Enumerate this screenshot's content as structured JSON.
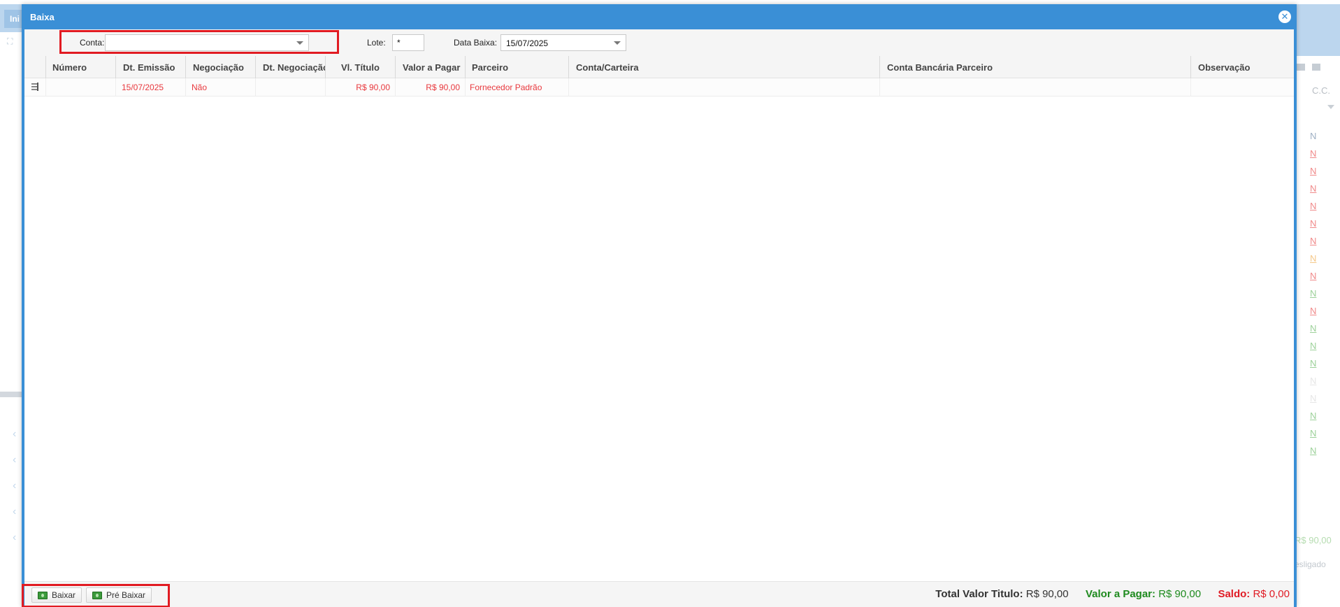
{
  "background": {
    "start_tab": "Ini",
    "cc_label": "C.C.",
    "status_letters": [
      "N",
      "N",
      "N",
      "N",
      "N",
      "N",
      "N",
      "N",
      "N",
      "N",
      "N",
      "N",
      "N",
      "N",
      "N",
      "N",
      "N",
      "N",
      "N"
    ],
    "status_colors": [
      "#9fb0c4",
      "#f08a8a",
      "#f08a8a",
      "#f08a8a",
      "#f08a8a",
      "#f08a8a",
      "#f08a8a",
      "#f5c98a",
      "#f08a8a",
      "#9dd19a",
      "#f08a8a",
      "#9dd19a",
      "#9dd19a",
      "#9dd19a",
      "#e6e6e6",
      "#e6e6e6",
      "#9dd19a",
      "#9dd19a",
      "#9dd19a"
    ],
    "partial_total": "R$ 90,00",
    "partial_status": "esligado"
  },
  "modal": {
    "title": "Baixa",
    "toolbar": {
      "conta_label": "Conta:",
      "conta_value": "",
      "lote_label": "Lote:",
      "lote_value": "*",
      "data_baixa_label": "Data Baixa:",
      "data_baixa_value": "15/07/2025"
    },
    "columns": [
      "Número",
      "Dt. Emissão",
      "Negociação",
      "Dt. Negociação",
      "Vl. Título",
      "Valor a Pagar",
      "Parceiro",
      "Conta/Carteira",
      "Conta Bancária Parceiro",
      "Observação"
    ],
    "rows": [
      {
        "numero": "",
        "dt_emissao": "15/07/2025",
        "negociacao": "Não",
        "dt_negociacao": "",
        "vl_titulo": "R$ 90,00",
        "valor_a_pagar": "R$ 90,00",
        "parceiro": "Fornecedor Padrão",
        "conta_carteira": "",
        "conta_bancaria_parceiro": "",
        "observacao": ""
      }
    ],
    "footer": {
      "baixar_label": "Baixar",
      "pre_baixar_label": "Pré Baixar",
      "total_valor_titulo_label": "Total Valor Titulo:",
      "total_valor_titulo": "R$ 90,00",
      "valor_a_pagar_label": "Valor a Pagar:",
      "valor_a_pagar": "R$ 90,00",
      "saldo_label": "Saldo:",
      "saldo": "R$ 0,00"
    },
    "colors": {
      "header": "#3a8fd6",
      "row_text": "#e8383d",
      "green": "#1e8a1e",
      "red": "#e01b24",
      "highlight": "#e11b22"
    }
  }
}
